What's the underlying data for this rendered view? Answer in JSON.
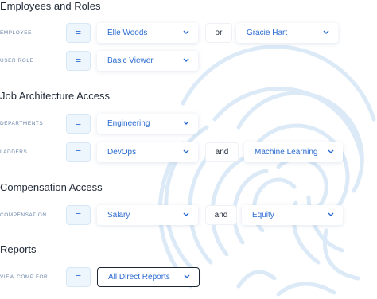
{
  "sections": {
    "employees": {
      "title": "Employees and Roles",
      "employee": {
        "label": "EMPLOYEE",
        "operator": "=",
        "value1": "Elle Woods",
        "conjunction": "or",
        "value2": "Gracie Hart"
      },
      "role": {
        "label": "USER ROLE",
        "operator": "=",
        "value": "Basic Viewer"
      }
    },
    "job": {
      "title": "Job Architecture Access",
      "departments": {
        "label": "DEPARTMENTS",
        "operator": "=",
        "value": "Engineering"
      },
      "ladders": {
        "label": "LADDERS",
        "operator": "=",
        "value1": "DevOps",
        "conjunction": "and",
        "value2": "Machine Learning"
      }
    },
    "compensation": {
      "title": "Compensation Access",
      "comp": {
        "label": "COMPENSATION",
        "operator": "=",
        "value1": "Salary",
        "conjunction": "and",
        "value2": "Equity"
      }
    },
    "reports": {
      "title": "Reports",
      "viewcomp": {
        "label": "VIEW COMP FOR",
        "operator": "=",
        "value": "All Direct Reports"
      }
    }
  },
  "colors": {
    "accent": "#2a6bd1",
    "label": "#6b86a8",
    "operator_bg": "#eef6fd",
    "fingerprint": "#dceaf7"
  }
}
